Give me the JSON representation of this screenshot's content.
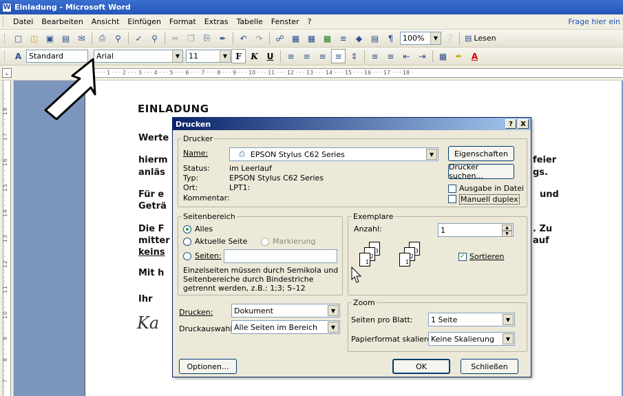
{
  "window": {
    "title": "Einladung - Microsoft Word",
    "app_icon": "W"
  },
  "menu": {
    "items": [
      "Datei",
      "Bearbeiten",
      "Ansicht",
      "Einfügen",
      "Format",
      "Extras",
      "Tabelle",
      "Fenster",
      "?"
    ],
    "help_prompt": "Frage hier ein"
  },
  "toolbar_standard": {
    "zoom": "100%",
    "read_label": "Lesen",
    "icons": [
      "new-document-icon",
      "open-icon",
      "save-icon",
      "permission-icon",
      "email-icon",
      "print-icon",
      "print-preview-icon",
      "spelling-icon",
      "research-icon",
      "cut-icon",
      "copy-icon",
      "paste-icon",
      "format-painter-icon",
      "undo-icon",
      "redo-icon",
      "hyperlink-icon",
      "tables-borders-icon",
      "insert-table-icon",
      "insert-excel-icon",
      "columns-icon",
      "drawing-icon",
      "document-map-icon",
      "show-formatting-icon"
    ]
  },
  "toolbar_format": {
    "style": "Standard",
    "font": "Arial",
    "size": "11",
    "bold": "F",
    "italic": "K",
    "underline": "U"
  },
  "ruler": {
    "horizontal": "· 1 · · · 1 · · · 2 · · · 3 · · · 4 · · · 5 · · · 6 · · · 7 · · · 8 · · · 9 · · · 10 · · · 11 · · · 12 · · · 13 · · · 14 · · · 15 · · · 16 · · · 17 · · · 18 ·",
    "vertical": "· 7 · · · 8 · · · 9 · · · 10 · · · 11 · · · 12 · · · 13 · · · 14 · · · 15 · · · 16 · · · 17 · · · 18 · · ·"
  },
  "document": {
    "title": "EINLADUNG",
    "lines_left": [
      "Werte",
      "hierm",
      "anläs",
      "Für e",
      "Geträ",
      "Die F",
      "mitter",
      "keins",
      "Mit h",
      "Ihr"
    ],
    "lines_right": [
      "feier",
      "gs.",
      "und",
      ". Zu",
      "auf"
    ],
    "signature": "Ka"
  },
  "dialog": {
    "title": "Drucken",
    "help_btn": "?",
    "close_btn": "X",
    "printer_group": "Drucker",
    "name_label": "Name:",
    "printer_name": "EPSON Stylus C62 Series",
    "properties_btn": "Eigenschaften",
    "find_printer_btn": "Drucker suchen...",
    "status_label": "Status:",
    "status_value": "im Leerlauf",
    "type_label": "Typ:",
    "type_value": "EPSON Stylus C62 Series",
    "location_label": "Ort:",
    "location_value": "LPT1:",
    "comment_label": "Kommentar:",
    "print_to_file": "Ausgabe in Datei",
    "manual_duplex": "Manuell duplex",
    "range_group": "Seitenbereich",
    "range_all": "Alles",
    "range_current": "Aktuelle Seite",
    "range_selection": "Markierung",
    "range_pages": "Seiten:",
    "range_hint": "Einzelseiten müssen durch Semikola und Seitenbereiche durch Bindestriche getrennt werden, z.B.: 1;3; 5–12",
    "copies_group": "Exemplare",
    "copies_label": "Anzahl:",
    "copies_value": "1",
    "collate_label": "Sortieren",
    "collate_checked": true,
    "sheet_numbers": [
      "3",
      "2",
      "1",
      "3",
      "2",
      "1"
    ],
    "print_what_label": "Drucken:",
    "print_what_value": "Dokument",
    "print_label": "Druckauswahl:",
    "print_value": "Alle Seiten im Bereich",
    "zoom_group": "Zoom",
    "pages_per_sheet_label": "Seiten pro Blatt:",
    "pages_per_sheet_value": "1 Seite",
    "scale_label": "Papierformat skalieren:",
    "scale_value": "Keine Skalierung",
    "options_btn": "Optionen...",
    "ok_btn": "OK",
    "close_dialog_btn": "Schließen"
  }
}
